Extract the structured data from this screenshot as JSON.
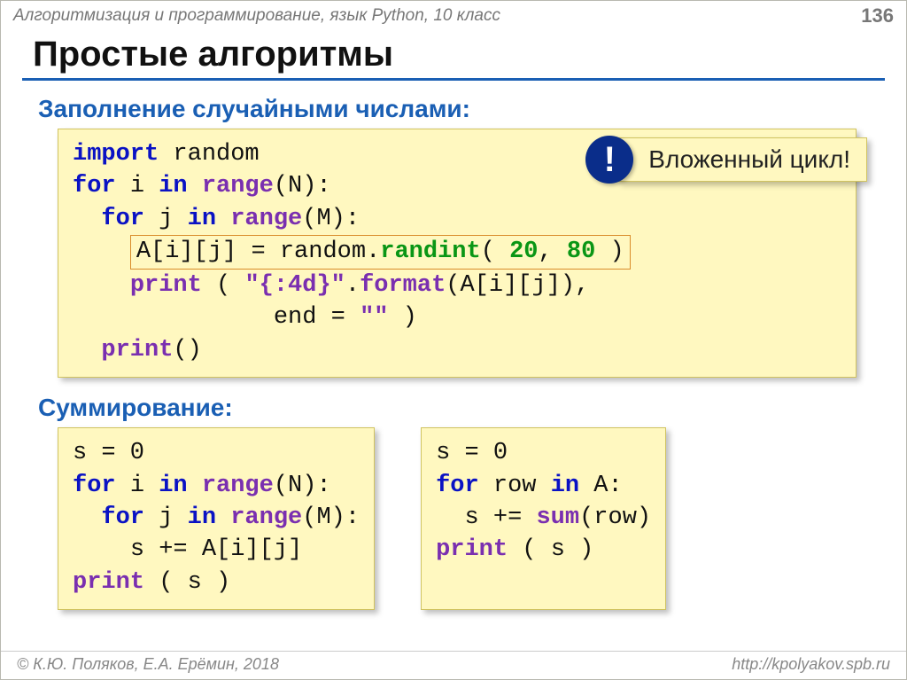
{
  "header": {
    "course": "Алгоритмизация и программирование, язык Python, 10 класс",
    "page": "136"
  },
  "title": "Простые алгоритмы",
  "sections": {
    "fill_random": "Заполнение случайными числами:",
    "sum": "Суммирование:"
  },
  "callout": {
    "mark": "!",
    "text": "Вложенный цикл!"
  },
  "code": {
    "import_kw": "import",
    "for_kw": "for",
    "in_kw": "in",
    "random_mod": "random",
    "range_fn": "range",
    "randint_fn": "randint",
    "print_fn": "print",
    "format_fn": "format",
    "sum_fn": "sum",
    "i": "i",
    "j": "j",
    "N": "N",
    "M": "M",
    "A": "A",
    "row": "row",
    "s": "s",
    "zero": "0",
    "twenty": "20",
    "eighty": "80",
    "fmt4d": "\"{:4d}\"",
    "empty": "\"\"",
    "end_kw": "end",
    "init_s": "s = 0",
    "inc_Aij": "s += A[i][j]",
    "inc_sumrow": "s += sum(row)",
    "print_s": "print ( s )"
  },
  "footer": {
    "left": "© К.Ю. Поляков, Е.А. Ерёмин, 2018",
    "right": "http://kpolyakov.spb.ru"
  }
}
